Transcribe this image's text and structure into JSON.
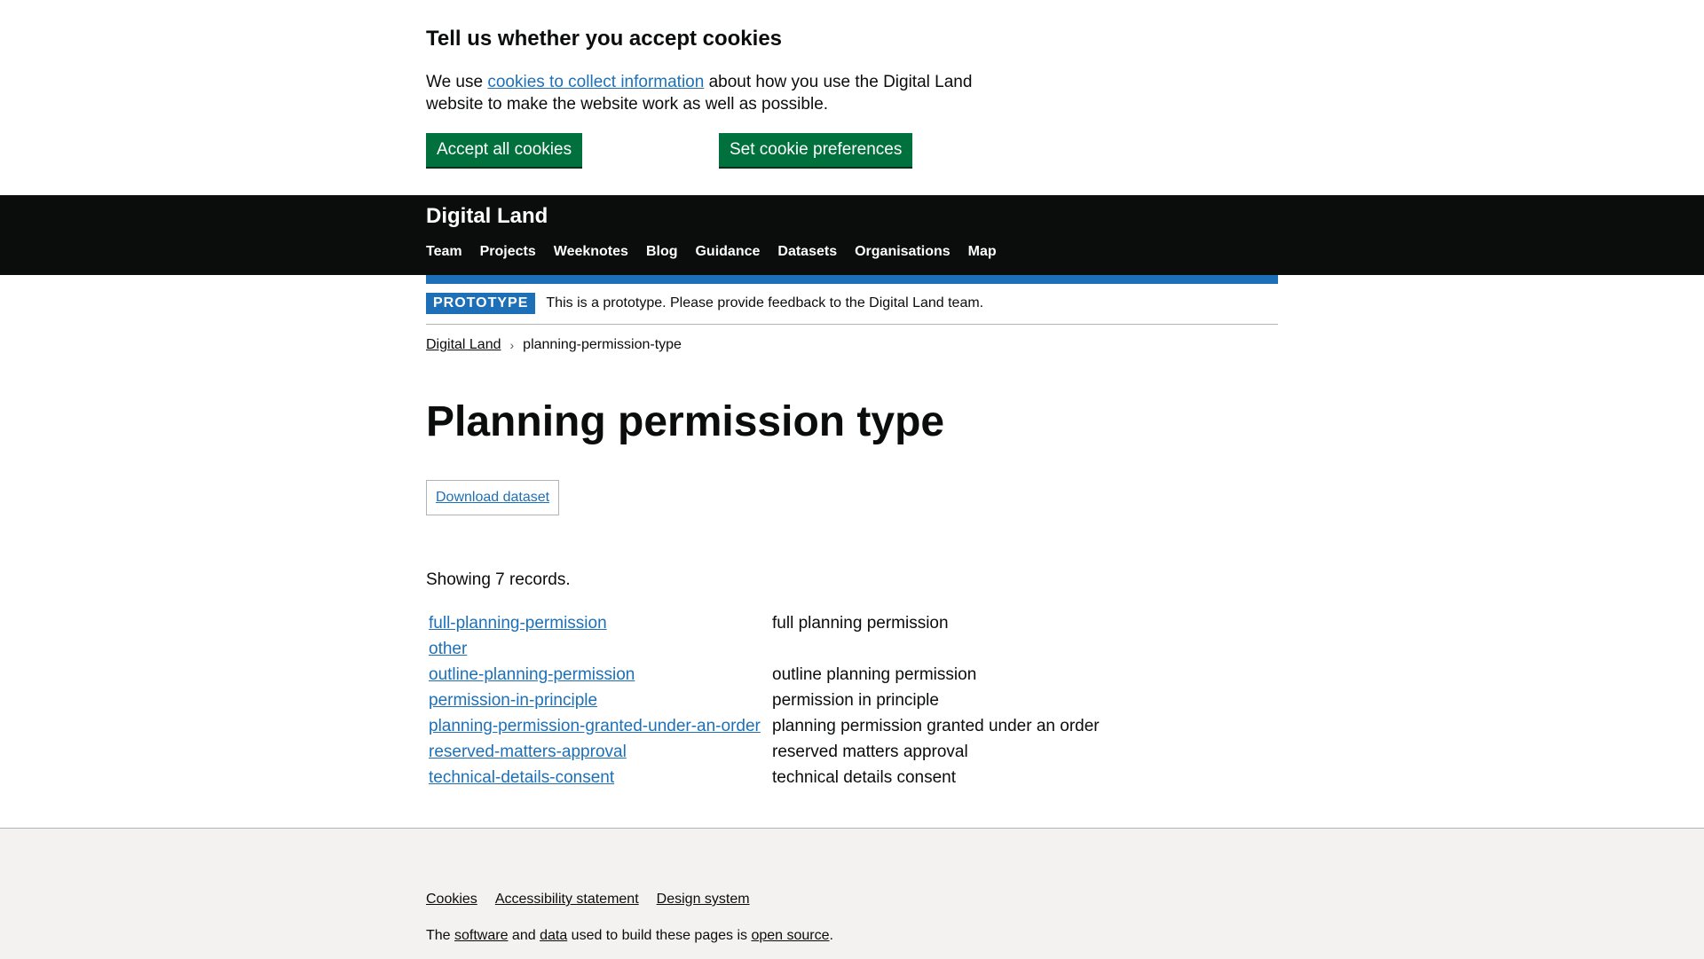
{
  "cookie_banner": {
    "heading": "Tell us whether you accept cookies",
    "text_before": "We use ",
    "link": "cookies to collect information",
    "text_after": " about how you use the Digital Land website to make the website work as well as possible.",
    "accept_label": "Accept all cookies",
    "preferences_label": "Set cookie preferences"
  },
  "header": {
    "logo": "Digital Land",
    "nav": [
      "Team",
      "Projects",
      "Weeknotes",
      "Blog",
      "Guidance",
      "Datasets",
      "Organisations",
      "Map"
    ]
  },
  "phase_banner": {
    "tag": "PROTOTYPE",
    "text": "This is a prototype. Please provide feedback to the Digital Land team."
  },
  "breadcrumb": {
    "home": "Digital Land",
    "current": "planning-permission-type"
  },
  "main": {
    "title": "Planning permission type",
    "download_label": "Download dataset",
    "count_text": "Showing 7 records.",
    "records": [
      {
        "id": "full-planning-permission",
        "name": "full planning permission"
      },
      {
        "id": "other",
        "name": ""
      },
      {
        "id": "outline-planning-permission",
        "name": "outline planning permission"
      },
      {
        "id": "permission-in-principle",
        "name": "permission in principle"
      },
      {
        "id": "planning-permission-granted-under-an-order",
        "name": "planning permission granted under an order"
      },
      {
        "id": "reserved-matters-approval",
        "name": "reserved matters approval"
      },
      {
        "id": "technical-details-consent",
        "name": "technical details consent"
      }
    ]
  },
  "footer": {
    "links": [
      "Cookies",
      "Accessibility statement",
      "Design system"
    ],
    "note_1": "The ",
    "software": "software",
    "note_2": " and ",
    "data": "data",
    "note_3": " used to build these pages is ",
    "open_source": "open source",
    "note_4": "."
  }
}
